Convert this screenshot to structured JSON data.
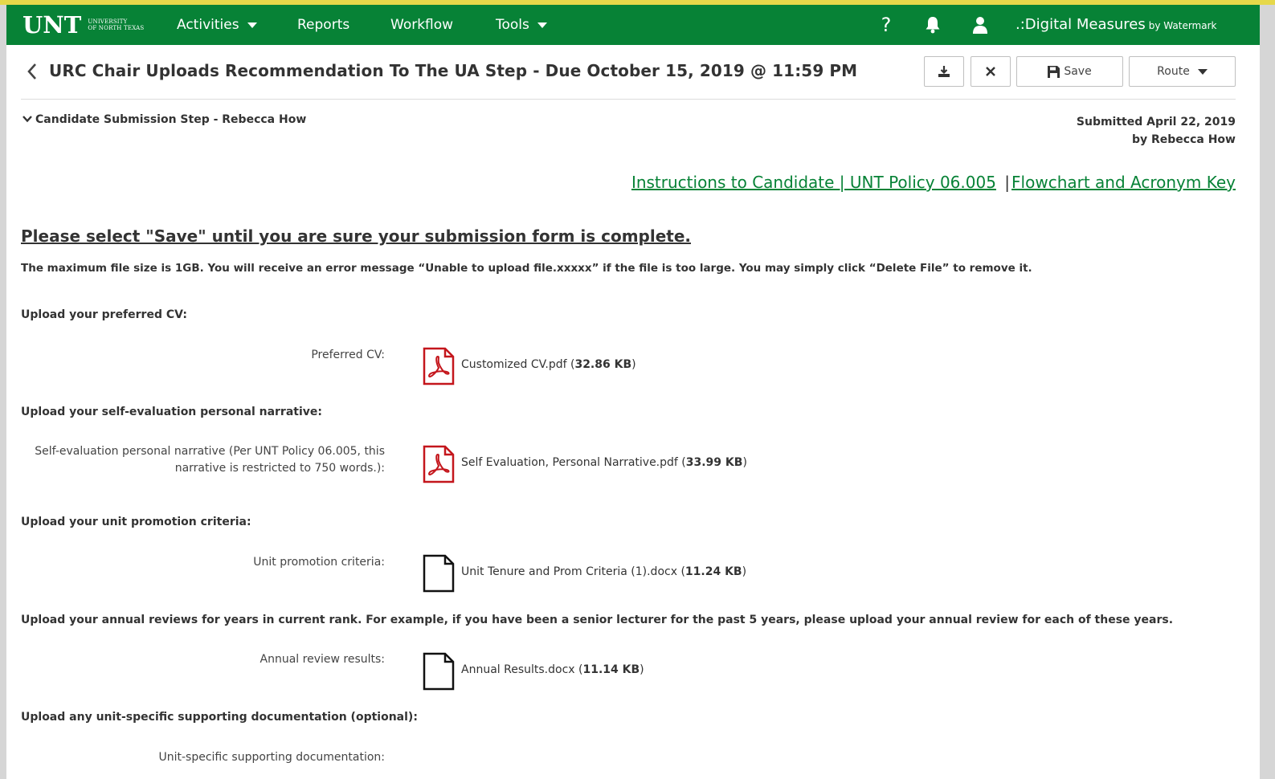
{
  "nav": {
    "logo": "UNT",
    "logo_sub_line1": "UNIVERSITY",
    "logo_sub_line2": "OF NORTH TEXAS",
    "activities": "Activities",
    "reports": "Reports",
    "workflow": "Workflow",
    "tools": "Tools",
    "help": "?",
    "brand": ".:Digital Measures",
    "brand_sub": "by Watermark"
  },
  "colors": {
    "nav_bg": "#078236",
    "link": "#078236",
    "pdf_red": "#c4161c"
  },
  "icons": [
    "chevron-left-icon",
    "download-icon",
    "close-icon",
    "save-icon",
    "caret-down-icon",
    "bell-icon",
    "user-icon",
    "pdf-icon",
    "document-icon",
    "chevron-down-icon"
  ],
  "header": {
    "title": "URC Chair Uploads Recommendation To The UA Step - Due October 15, 2019 @ 11:59 PM",
    "save_label": "Save",
    "route_label": "Route"
  },
  "step": {
    "label": "Candidate Submission Step - Rebecca How",
    "submitted_line1": "Submitted April 22, 2019",
    "submitted_line2": "by Rebecca How"
  },
  "links": {
    "instructions": "Instructions to Candidate | UNT Policy 06.005",
    "separator": "|",
    "flowchart": "Flowchart and Acronym Key"
  },
  "notice": {
    "warning": "Please select \"Save\" until you are sure your submission form is complete.",
    "max_size": "The maximum file size is 1GB.  You will receive an error message “Unable to upload file.xxxxx” if the file is too large. You may simply click “Delete File” to remove it."
  },
  "sections": [
    {
      "heading": "Upload your preferred CV:",
      "label": "Preferred CV:",
      "file": "Customized CV.pdf",
      "size": "32.86 KB",
      "type": "pdf"
    },
    {
      "heading": "Upload your self-evaluation personal narrative:",
      "label_line1": "Self-evaluation personal narrative (Per UNT Policy 06.005, this",
      "label_line2": "narrative is restricted to 750 words.):",
      "file": "Self Evaluation, Personal Narrative.pdf",
      "size": "33.99 KB",
      "type": "pdf"
    },
    {
      "heading": "Upload your unit promotion criteria:",
      "label": "Unit promotion criteria:",
      "file": "Unit Tenure and Prom Criteria (1).docx",
      "size": "11.24 KB",
      "type": "doc"
    },
    {
      "heading": "Upload your annual reviews for years in current rank.  For example, if you have been a senior lecturer for the past 5 years, please upload your annual review for each of these years.",
      "label": "Annual review results:",
      "file": "Annual Results.docx",
      "size": "11.14 KB",
      "type": "doc"
    },
    {
      "heading": "Upload any unit-specific supporting documentation (optional):",
      "label": "Unit-specific supporting documentation:"
    }
  ]
}
